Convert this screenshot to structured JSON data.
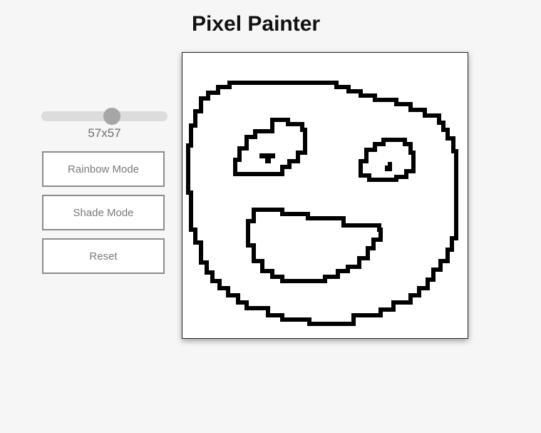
{
  "header": {
    "title": "Pixel Painter"
  },
  "controls": {
    "grid_size_slider": {
      "min": 1,
      "max": 100,
      "value": 57
    },
    "size_label": "57x57",
    "buttons": {
      "rainbow": "Rainbow Mode",
      "shade": "Shade Mode",
      "reset": "Reset"
    }
  },
  "canvas": {
    "grid_size": 57,
    "background_color": "#ffffff",
    "ink_color": "#000000",
    "drawing": "smiley-face"
  }
}
